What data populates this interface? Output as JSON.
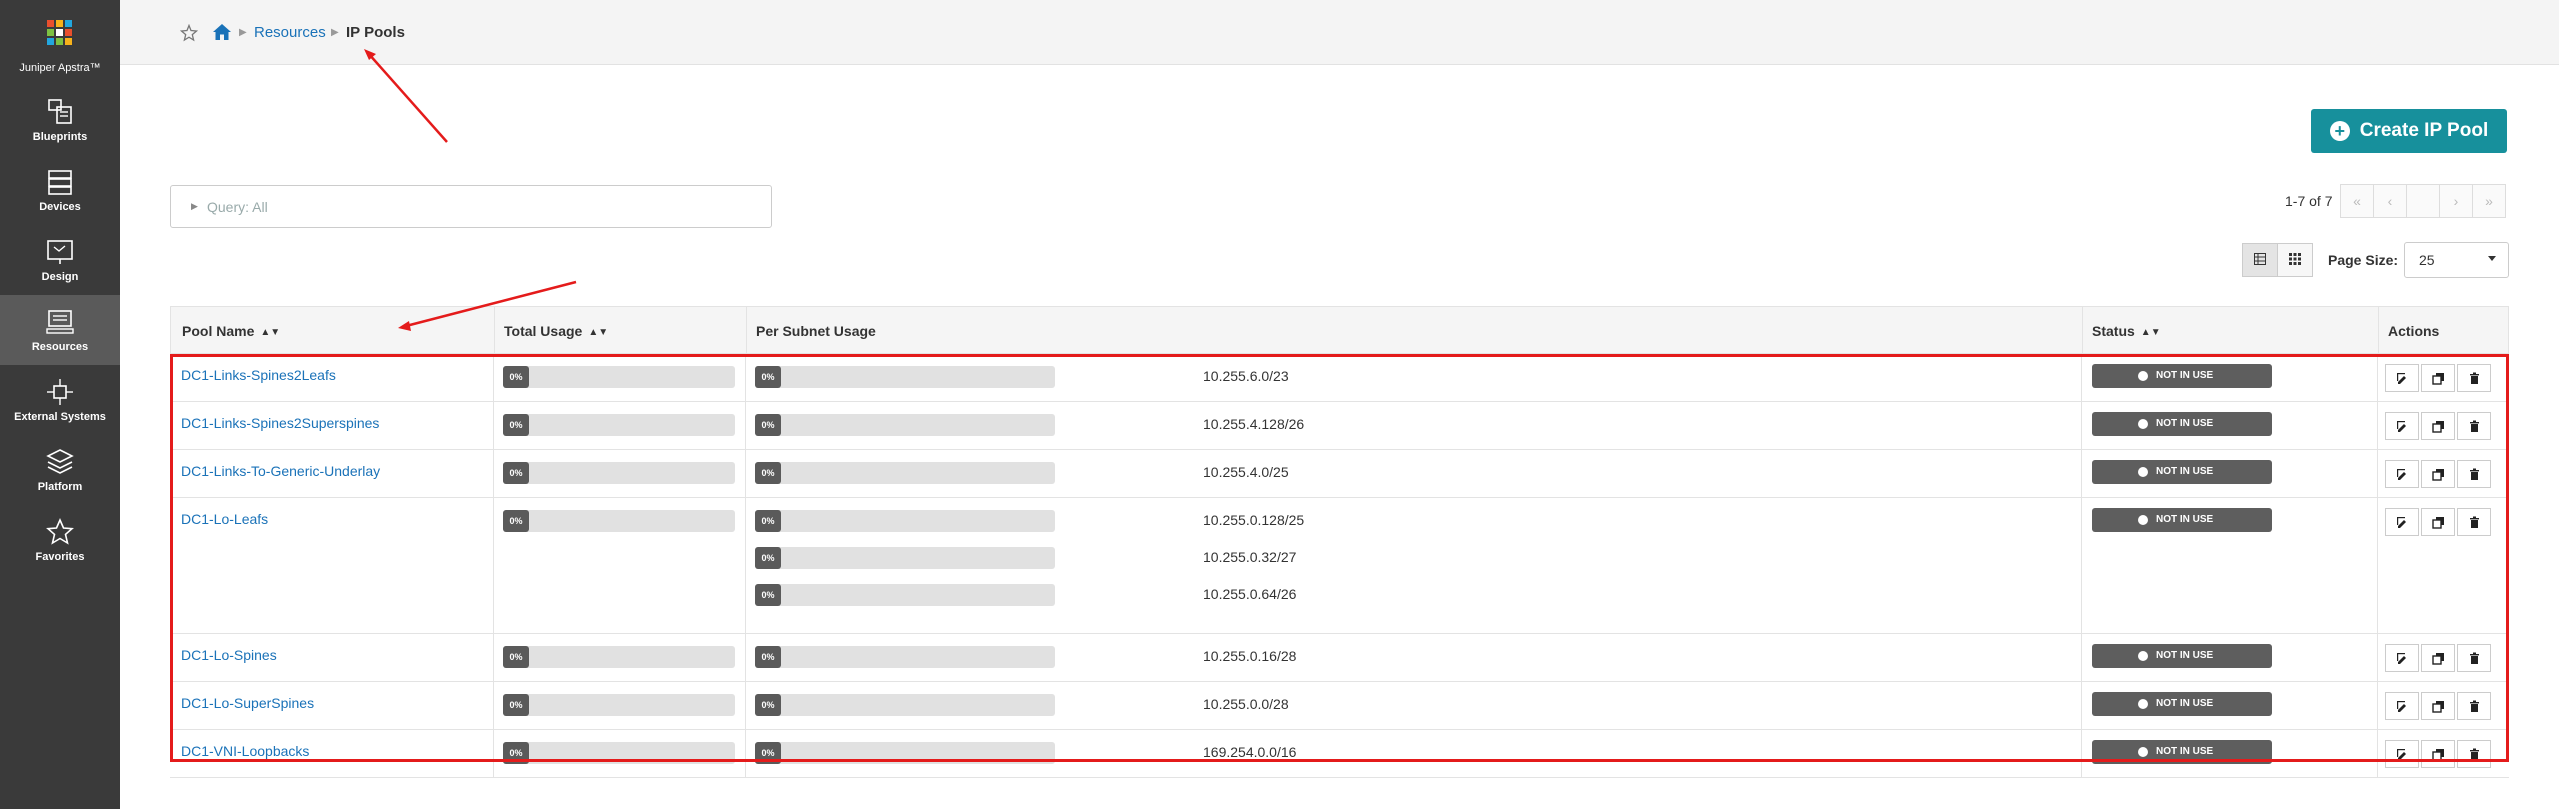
{
  "sidebar": {
    "brand": "Juniper Apstra™",
    "items": [
      {
        "label": "Blueprints",
        "icon": "blueprints-icon"
      },
      {
        "label": "Devices",
        "icon": "devices-icon"
      },
      {
        "label": "Design",
        "icon": "design-icon"
      },
      {
        "label": "Resources",
        "icon": "resources-icon",
        "active": true
      },
      {
        "label": "External Systems",
        "icon": "external-systems-icon"
      },
      {
        "label": "Platform",
        "icon": "platform-icon"
      },
      {
        "label": "Favorites",
        "icon": "star-icon"
      }
    ]
  },
  "breadcrumb": {
    "resources": "Resources",
    "current": "IP Pools"
  },
  "create_button": "Create IP Pool",
  "query": "Query: All",
  "pagination": {
    "count": "1-7 of 7",
    "page_size_label": "Page Size:",
    "page_size": "25"
  },
  "table": {
    "headers": {
      "pool_name": "Pool Name",
      "total_usage": "Total Usage",
      "per_subnet_usage": "Per Subnet Usage",
      "status": "Status",
      "actions": "Actions"
    },
    "rows": [
      {
        "name": "DC1-Links-Spines2Leafs",
        "total": "0%",
        "subnets": [
          {
            "pct": "0%",
            "cidr": "10.255.6.0/23"
          }
        ],
        "status": "NOT IN USE"
      },
      {
        "name": "DC1-Links-Spines2Superspines",
        "total": "0%",
        "subnets": [
          {
            "pct": "0%",
            "cidr": "10.255.4.128/26"
          }
        ],
        "status": "NOT IN USE"
      },
      {
        "name": "DC1-Links-To-Generic-Underlay",
        "total": "0%",
        "subnets": [
          {
            "pct": "0%",
            "cidr": "10.255.4.0/25"
          }
        ],
        "status": "NOT IN USE"
      },
      {
        "name": "DC1-Lo-Leafs",
        "total": "0%",
        "subnets": [
          {
            "pct": "0%",
            "cidr": "10.255.0.128/25"
          },
          {
            "pct": "0%",
            "cidr": "10.255.0.32/27"
          },
          {
            "pct": "0%",
            "cidr": "10.255.0.64/26"
          }
        ],
        "status": "NOT IN USE"
      },
      {
        "name": "DC1-Lo-Spines",
        "total": "0%",
        "subnets": [
          {
            "pct": "0%",
            "cidr": "10.255.0.16/28"
          }
        ],
        "status": "NOT IN USE"
      },
      {
        "name": "DC1-Lo-SuperSpines",
        "total": "0%",
        "subnets": [
          {
            "pct": "0%",
            "cidr": "10.255.0.0/28"
          }
        ],
        "status": "NOT IN USE"
      },
      {
        "name": "DC1-VNI-Loopbacks",
        "total": "0%",
        "subnets": [
          {
            "pct": "0%",
            "cidr": "169.254.0.0/16"
          }
        ],
        "status": "NOT IN USE"
      }
    ]
  },
  "colors": {
    "sidebar_bg": "#3a3a3a",
    "accent": "#17909c",
    "link": "#1a72b8",
    "annotation": "#e41b1b"
  }
}
